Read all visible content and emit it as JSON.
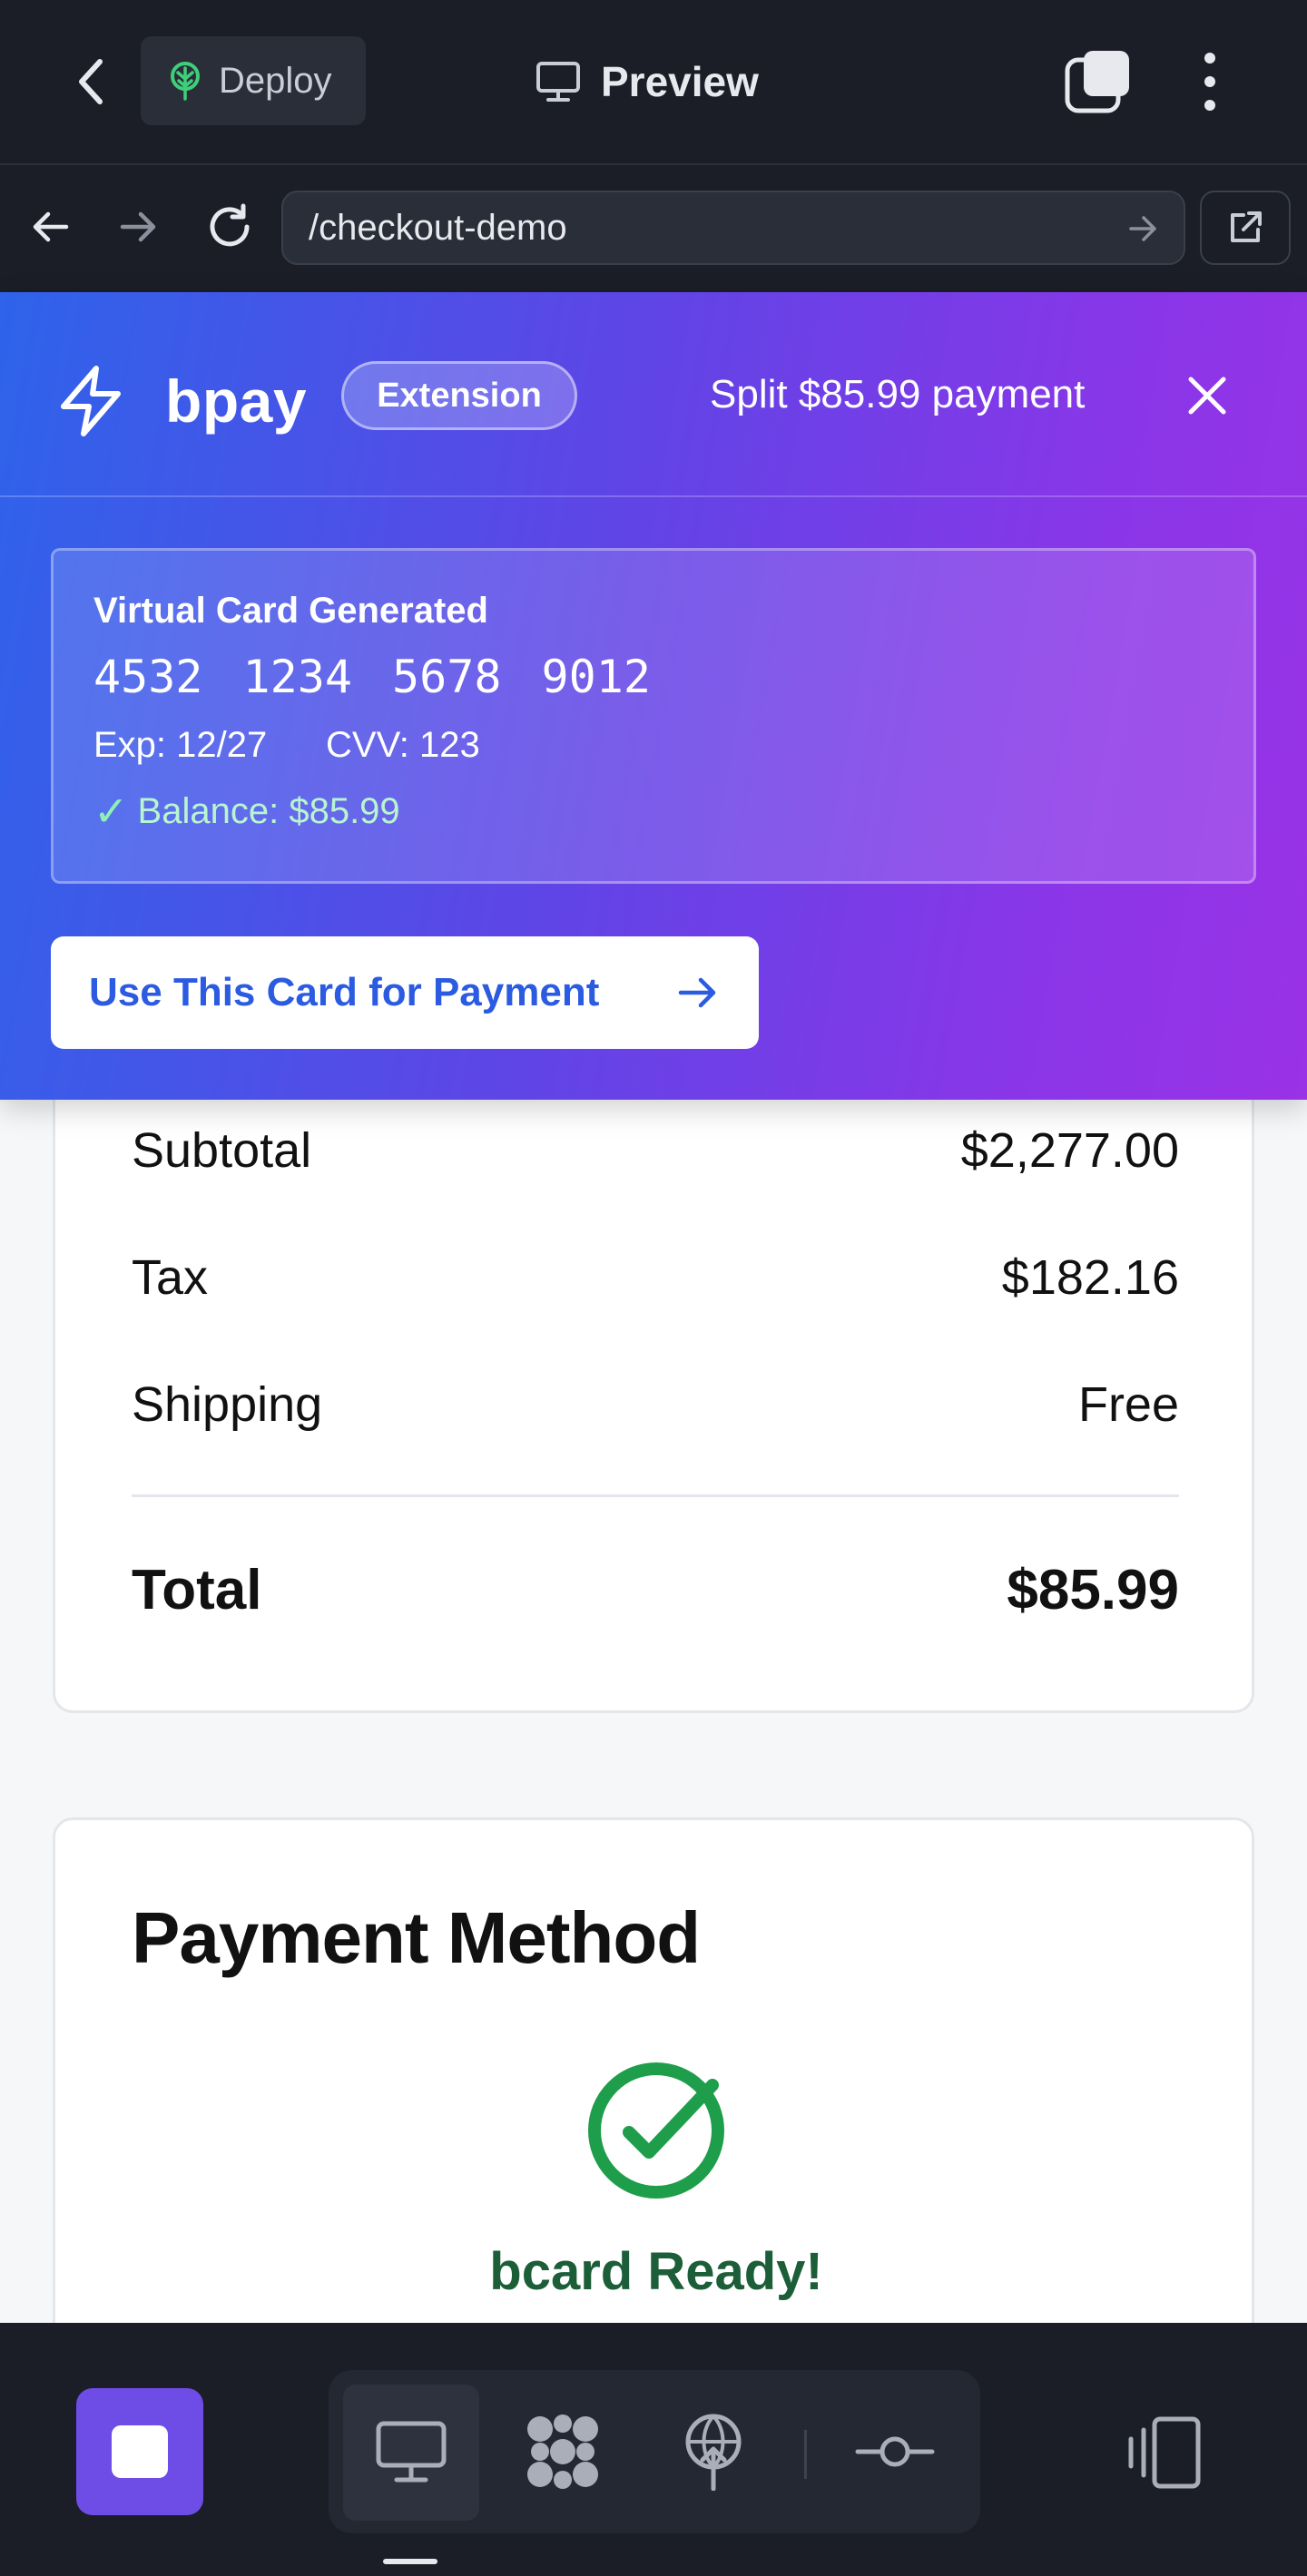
{
  "topbar": {
    "deploy_label": "Deploy",
    "preview_label": "Preview"
  },
  "urlbar": {
    "url": "/checkout-demo"
  },
  "extension": {
    "brand": "bpay",
    "badge": "Extension",
    "split_text": "Split $85.99 payment",
    "virtual_card": {
      "title": "Virtual Card Generated",
      "number": "4532 1234 5678 9012",
      "exp": "Exp: 12/27",
      "cvv": "CVV: 123",
      "balance": "Balance: $85.99"
    },
    "use_card_label": "Use This Card for Payment"
  },
  "summary": {
    "rows": [
      {
        "label": "Subtotal",
        "value": "$2,277.00"
      },
      {
        "label": "Tax",
        "value": "$182.16"
      },
      {
        "label": "Shipping",
        "value": "Free"
      }
    ],
    "total_label": "Total",
    "total_value": "$85.99"
  },
  "payment": {
    "title": "Payment Method",
    "status": "bcard Ready!"
  },
  "colors": {
    "accent_blue": "#2b5be0",
    "gradient_start": "#2e63ea",
    "gradient_end": "#9a32e6",
    "success_green": "#1e9e4a",
    "stop_purple": "#6e4de6"
  },
  "icons": {
    "back": "chevron-left-icon",
    "deploy": "tree-icon",
    "preview": "monitor-icon",
    "tabs": "tabs-icon",
    "menu": "kebab-menu-icon",
    "extension": "bolt-icon",
    "close": "close-icon",
    "success": "check-circle-icon"
  }
}
